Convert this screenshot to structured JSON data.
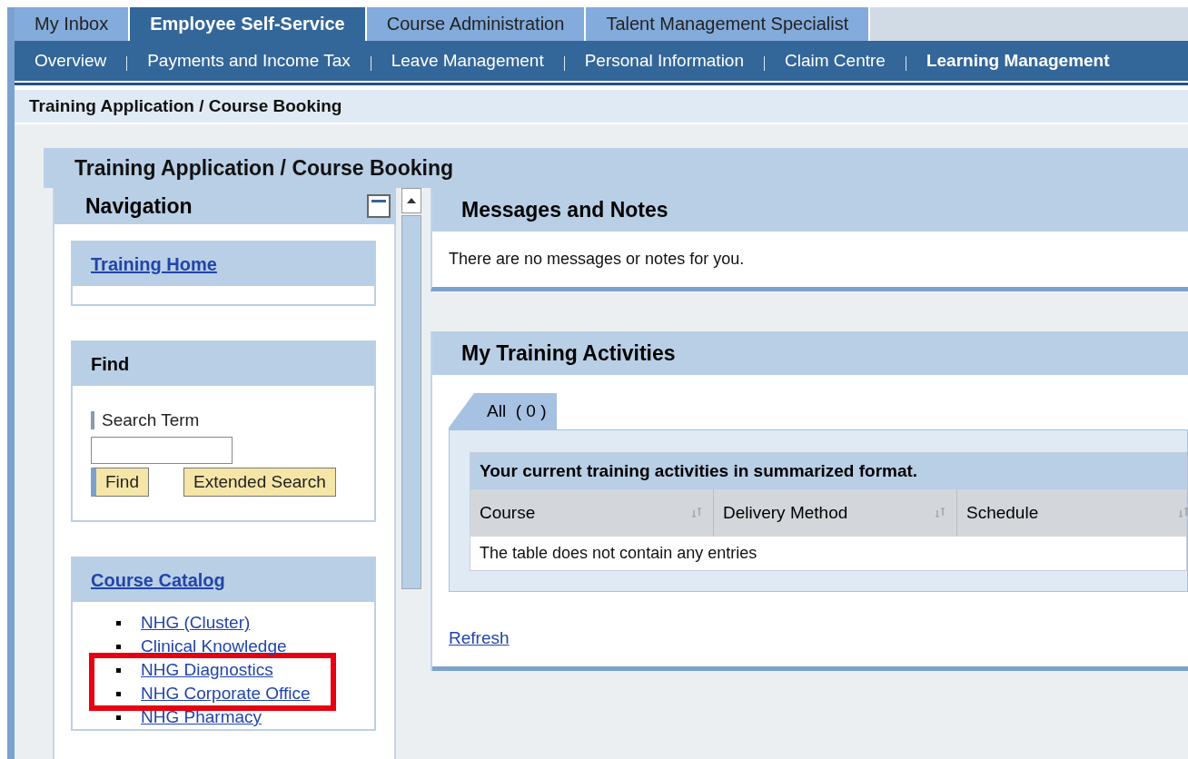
{
  "top_tabs": [
    {
      "label": "My Inbox",
      "selected": false
    },
    {
      "label": "Employee Self-Service",
      "selected": true
    },
    {
      "label": "Course Administration",
      "selected": false
    },
    {
      "label": "Talent Management Specialist",
      "selected": false
    }
  ],
  "sub_nav": [
    {
      "label": "Overview",
      "selected": false
    },
    {
      "label": "Payments and Income Tax",
      "selected": false
    },
    {
      "label": "Leave Management",
      "selected": false
    },
    {
      "label": "Personal Information",
      "selected": false
    },
    {
      "label": "Claim Centre",
      "selected": false
    },
    {
      "label": "Learning Management",
      "selected": true
    }
  ],
  "breadcrumb": "Training Application / Course Booking",
  "page_title": "Training Application / Course Booking",
  "navigation": {
    "title": "Navigation",
    "training_home": {
      "link": "Training Home"
    },
    "find": {
      "title": "Find",
      "label": "Search Term",
      "buttons": [
        "Find",
        "Extended Search"
      ]
    },
    "course_catalog": {
      "link": "Course Catalog",
      "items": [
        {
          "label": "NHG (Cluster)",
          "highlighted": false
        },
        {
          "label": "Clinical Knowledge",
          "highlighted": false
        },
        {
          "label": "NHG Diagnostics",
          "highlighted": true
        },
        {
          "label": "NHG Corporate Office",
          "highlighted": true
        },
        {
          "label": "NHG Pharmacy",
          "highlighted": false
        }
      ]
    }
  },
  "messages": {
    "title": "Messages and Notes",
    "text": "There are no messages or notes for you."
  },
  "activities": {
    "title": "My Training Activities",
    "tabs": [
      {
        "label": "All",
        "count": "( 0 )",
        "selected": true
      }
    ],
    "table": {
      "caption": "Your current training activities in summarized format.",
      "columns": [
        "Course",
        "Delivery Method",
        "Schedule"
      ],
      "empty_text": "The table does not contain any entries"
    },
    "refresh": "Refresh"
  }
}
